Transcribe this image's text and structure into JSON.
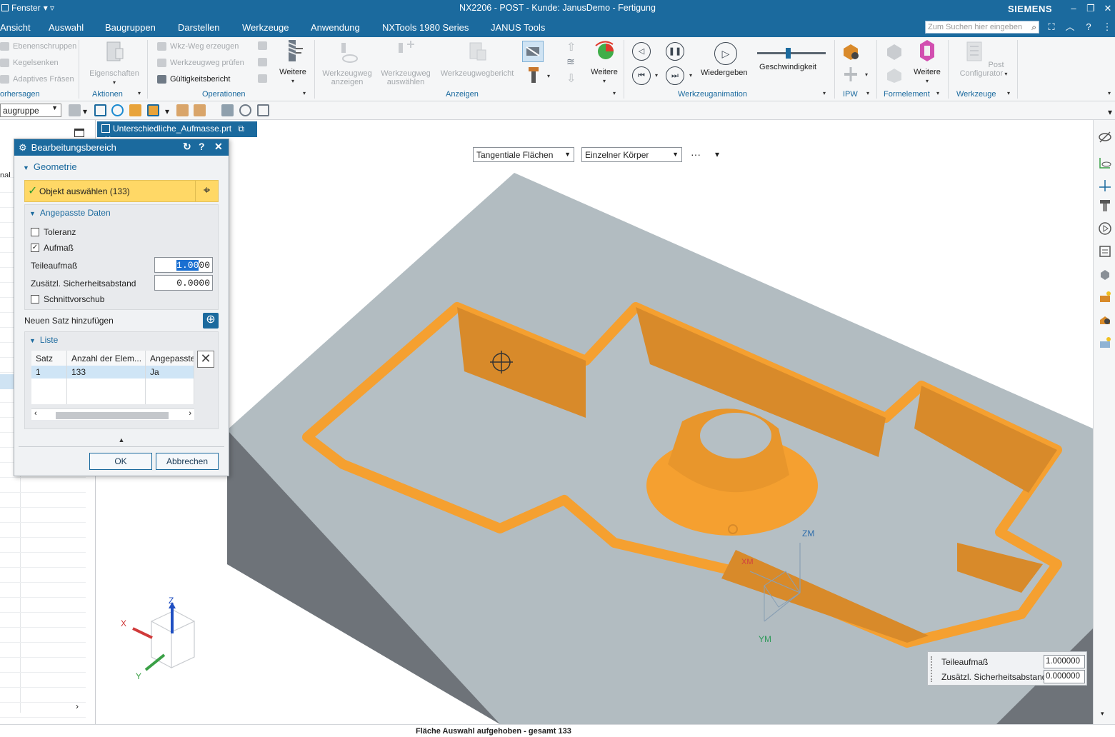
{
  "titlebar": {
    "window_menu": "Fenster",
    "title": "NX2206 - POST - Kunde: JanusDemo - Fertigung",
    "brand": "SIEMENS"
  },
  "menu": {
    "items": [
      "Ansicht",
      "Auswahl",
      "Baugruppen",
      "Darstellen",
      "Werkzeuge",
      "Anwendung",
      "NXTools 1980 Series",
      "JANUS Tools"
    ],
    "search_placeholder": "Zum Suchen hier eingeben"
  },
  "ribbon": {
    "vorhersagen_items": [
      "Ebenenschruppen",
      "Kegelsenken",
      "Adaptives Fräsen"
    ],
    "vorhersagen_label": "orhersagen",
    "eigenschaften": "Eigenschaften",
    "aktionen_label": "Aktionen",
    "op_items": [
      "Wkz-Weg erzeugen",
      "Werkzeugweg prüfen",
      "Gültigkeitsbericht"
    ],
    "weitere_ops": "Weitere",
    "operationen_label": "Operationen",
    "anzeigen_items": [
      "Werkzeugweg anzeigen",
      "Werkzeugweg auswählen",
      "Werkzeugwegbericht"
    ],
    "weitere_anz": "Weitere",
    "anzeigen_label": "Anzeigen",
    "wiedergeben": "Wiedergeben",
    "geschwindigkeit": "Geschwindigkeit",
    "geschwindigkeit_level": 0.45,
    "animation_label": "Werkzeuganimation",
    "ipw_label": "IPW",
    "weitere_form": "Weitere",
    "formelement_label": "Formelement",
    "post_configurator": "Post Configurator",
    "werkzeuge_label": "Werkzeuge"
  },
  "toolbar2": {
    "filter_value": "augruppe"
  },
  "filetab": {
    "name": "Unterschiedliche_Aufmasse.prt"
  },
  "viewport_filters": {
    "face_rule": "Tangentiale Flächen",
    "body_rule": "Einzelner Körper",
    "more": "···"
  },
  "navigator": {
    "header_fragment": "nal"
  },
  "dialog": {
    "title": "Bearbeitungsbereich",
    "geometrie": "Geometrie",
    "select_label": "Objekt auswählen (133)",
    "angepasste_daten": "Angepasste Daten",
    "toleranz": "Toleranz",
    "aufmass": "Aufmaß",
    "teileaufmass_label": "Teileaufmaß",
    "teileaufmass_sel": "1.00",
    "teileaufmass_rest": "00",
    "sicherheit_label": "Zusätzl. Sicherheitsabstand",
    "sicherheit_value": "0.0000",
    "schnittvorschub": "Schnittvorschub",
    "neuen_satz": "Neuen Satz hinzufügen",
    "liste": "Liste",
    "columns": [
      "Satz",
      "Anzahl der Elem...",
      "Angepasste"
    ],
    "rows": [
      [
        "1",
        "133",
        "Ja"
      ]
    ],
    "ok": "OK",
    "cancel": "Abbrechen"
  },
  "triad": {
    "x": "X",
    "y": "Y",
    "z": "Z"
  },
  "csys": {
    "zm": "ZM",
    "ym": "YM",
    "xm": "XM"
  },
  "dyninput": {
    "teileaufmass_label": "Teileaufmaß",
    "teileaufmass_value": "1.000000",
    "sicherheit_label": "Zusätzl. Sicherheitsabstand",
    "sicherheit_value": "0.000000"
  },
  "status": "Fläche Auswahl aufgehoben - gesamt 133",
  "colors": {
    "accent": "#1b6a9e",
    "highlight": "#ffd866",
    "selected_faces": "#f5a030"
  }
}
